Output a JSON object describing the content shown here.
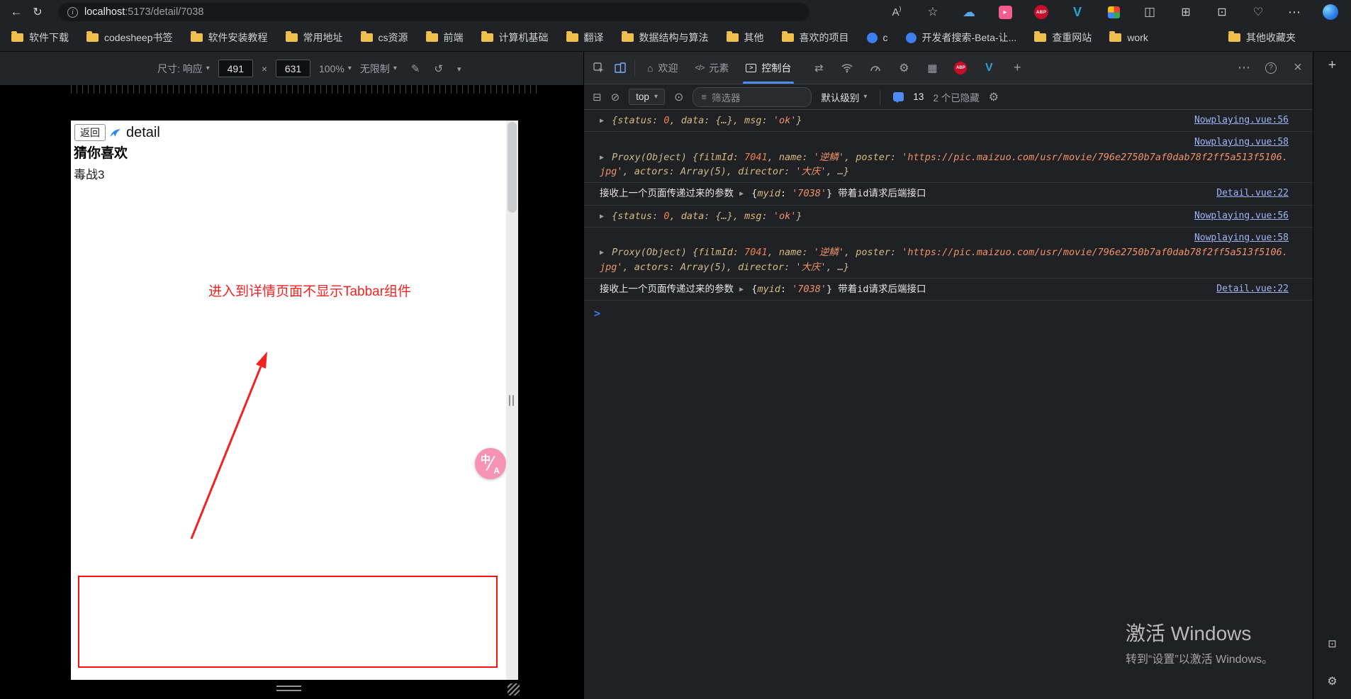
{
  "chrome": {
    "url": {
      "host": "localhost",
      "path": ":5173/detail/7038"
    }
  },
  "bookmarks": {
    "items": [
      {
        "label": "软件下载",
        "icon": "folder"
      },
      {
        "label": "codesheep书签",
        "icon": "folder"
      },
      {
        "label": "软件安装教程",
        "icon": "folder"
      },
      {
        "label": "常用地址",
        "icon": "folder"
      },
      {
        "label": "cs资源",
        "icon": "folder"
      },
      {
        "label": "前端",
        "icon": "folder"
      },
      {
        "label": "计算机基础",
        "icon": "folder"
      },
      {
        "label": "翻译",
        "icon": "folder"
      },
      {
        "label": "数据结构与算法",
        "icon": "folder"
      },
      {
        "label": "其他",
        "icon": "folder"
      },
      {
        "label": "喜欢的项目",
        "icon": "folder"
      },
      {
        "label": "c",
        "icon": "site"
      },
      {
        "label": "开发者搜索-Beta-让...",
        "icon": "site"
      },
      {
        "label": "查重网站",
        "icon": "folder"
      },
      {
        "label": "work",
        "icon": "folder"
      }
    ],
    "overflow_label": "其他收藏夹"
  },
  "device_toolbar": {
    "dimensions_label": "尺寸: 响应",
    "width_value": "491",
    "multiply": "×",
    "height_value": "631",
    "zoom_value": "100%",
    "throttling_value": "无限制"
  },
  "emulated_page": {
    "back_button": "返回",
    "page_title": "detail",
    "section_heading": "猜你喜欢",
    "movie_title": "毒战3",
    "annotation": "进入到详情页面不显示Tabbar组件",
    "translate_zh": "中",
    "translate_en": "A"
  },
  "devtools": {
    "tabs": [
      {
        "name": "welcome",
        "label": "欢迎",
        "icon": "home",
        "active": false
      },
      {
        "name": "elements",
        "label": "元素",
        "icon": "elements",
        "active": false
      },
      {
        "name": "console",
        "label": "控制台",
        "icon": "console",
        "active": true
      }
    ],
    "toolbar": {
      "context": "top",
      "filter_placeholder": "筛选器",
      "level": "默认级别",
      "message_count": "13",
      "hidden_count": "2 个已隐藏"
    },
    "console": {
      "messages": [
        {
          "layout": "single",
          "source": "Nowplaying.vue:56",
          "tokens": [
            {
              "c": "caret",
              "t": "▶"
            },
            {
              "c": "pv",
              "t": " {"
            },
            {
              "c": "key",
              "t": "status"
            },
            {
              "c": "pv",
              "t": ": "
            },
            {
              "c": "num",
              "t": "0"
            },
            {
              "c": "pv",
              "t": ", "
            },
            {
              "c": "key",
              "t": "data"
            },
            {
              "c": "pv",
              "t": ": {…}, "
            },
            {
              "c": "key",
              "t": "msg"
            },
            {
              "c": "pv",
              "t": ": "
            },
            {
              "c": "str",
              "t": "'ok'"
            },
            {
              "c": "pv",
              "t": "}"
            }
          ]
        },
        {
          "layout": "wide",
          "source": "Nowplaying.vue:58",
          "tokens": [
            {
              "c": "caret",
              "t": "▶"
            },
            {
              "c": "pv",
              "t": " Proxy(Object) {"
            },
            {
              "c": "key",
              "t": "filmId"
            },
            {
              "c": "pv",
              "t": ": "
            },
            {
              "c": "num",
              "t": "7041"
            },
            {
              "c": "pv",
              "t": ", "
            },
            {
              "c": "key",
              "t": "name"
            },
            {
              "c": "pv",
              "t": ": "
            },
            {
              "c": "str",
              "t": "'逆鳞'"
            },
            {
              "c": "pv",
              "t": ", "
            },
            {
              "c": "key",
              "t": "poster"
            },
            {
              "c": "pv",
              "t": ": "
            },
            {
              "c": "str",
              "t": "'https://pic.maizuo.com/usr/movie/796e2750b7af0dab78f2ff5a513f5106.jpg'"
            },
            {
              "c": "pv",
              "t": ", "
            },
            {
              "c": "key",
              "t": "actors"
            },
            {
              "c": "pv",
              "t": ": Array(5), "
            },
            {
              "c": "key",
              "t": "director"
            },
            {
              "c": "pv",
              "t": ": "
            },
            {
              "c": "str",
              "t": "'大庆'"
            },
            {
              "c": "pv",
              "t": ", …}"
            }
          ]
        },
        {
          "layout": "single",
          "source": "Detail.vue:22",
          "tokens": [
            {
              "c": "plain",
              "t": "接收上一个页面传递过来的参数  "
            },
            {
              "c": "caret",
              "t": "▶"
            },
            {
              "c": "plain",
              "t": " {"
            },
            {
              "c": "key",
              "t": "myid"
            },
            {
              "c": "plain",
              "t": ": "
            },
            {
              "c": "str",
              "t": "'7038'"
            },
            {
              "c": "plain",
              "t": "}  带着id请求后端接口"
            }
          ]
        },
        {
          "layout": "single",
          "source": "Nowplaying.vue:56",
          "tokens": [
            {
              "c": "caret",
              "t": "▶"
            },
            {
              "c": "pv",
              "t": " {"
            },
            {
              "c": "key",
              "t": "status"
            },
            {
              "c": "pv",
              "t": ": "
            },
            {
              "c": "num",
              "t": "0"
            },
            {
              "c": "pv",
              "t": ", "
            },
            {
              "c": "key",
              "t": "data"
            },
            {
              "c": "pv",
              "t": ": {…}, "
            },
            {
              "c": "key",
              "t": "msg"
            },
            {
              "c": "pv",
              "t": ": "
            },
            {
              "c": "str",
              "t": "'ok'"
            },
            {
              "c": "pv",
              "t": "}"
            }
          ]
        },
        {
          "layout": "wide",
          "source": "Nowplaying.vue:58",
          "tokens": [
            {
              "c": "caret",
              "t": "▶"
            },
            {
              "c": "pv",
              "t": " Proxy(Object) {"
            },
            {
              "c": "key",
              "t": "filmId"
            },
            {
              "c": "pv",
              "t": ": "
            },
            {
              "c": "num",
              "t": "7041"
            },
            {
              "c": "pv",
              "t": ", "
            },
            {
              "c": "key",
              "t": "name"
            },
            {
              "c": "pv",
              "t": ": "
            },
            {
              "c": "str",
              "t": "'逆鳞'"
            },
            {
              "c": "pv",
              "t": ", "
            },
            {
              "c": "key",
              "t": "poster"
            },
            {
              "c": "pv",
              "t": ": "
            },
            {
              "c": "str",
              "t": "'https://pic.maizuo.com/usr/movie/796e2750b7af0dab78f2ff5a513f5106.jpg'"
            },
            {
              "c": "pv",
              "t": ", "
            },
            {
              "c": "key",
              "t": "actors"
            },
            {
              "c": "pv",
              "t": ": Array(5), "
            },
            {
              "c": "key",
              "t": "director"
            },
            {
              "c": "pv",
              "t": ": "
            },
            {
              "c": "str",
              "t": "'大庆'"
            },
            {
              "c": "pv",
              "t": ", …}"
            }
          ]
        },
        {
          "layout": "single",
          "source": "Detail.vue:22",
          "tokens": [
            {
              "c": "plain",
              "t": "接收上一个页面传递过来的参数  "
            },
            {
              "c": "caret",
              "t": "▶"
            },
            {
              "c": "plain",
              "t": " {"
            },
            {
              "c": "key",
              "t": "myid"
            },
            {
              "c": "plain",
              "t": ": "
            },
            {
              "c": "str",
              "t": "'7038'"
            },
            {
              "c": "plain",
              "t": "}  带着id请求后端接口"
            }
          ]
        }
      ]
    }
  },
  "watermark": {
    "line1": "激活 Windows",
    "line2": "转到“设置”以激活 Windows。"
  }
}
